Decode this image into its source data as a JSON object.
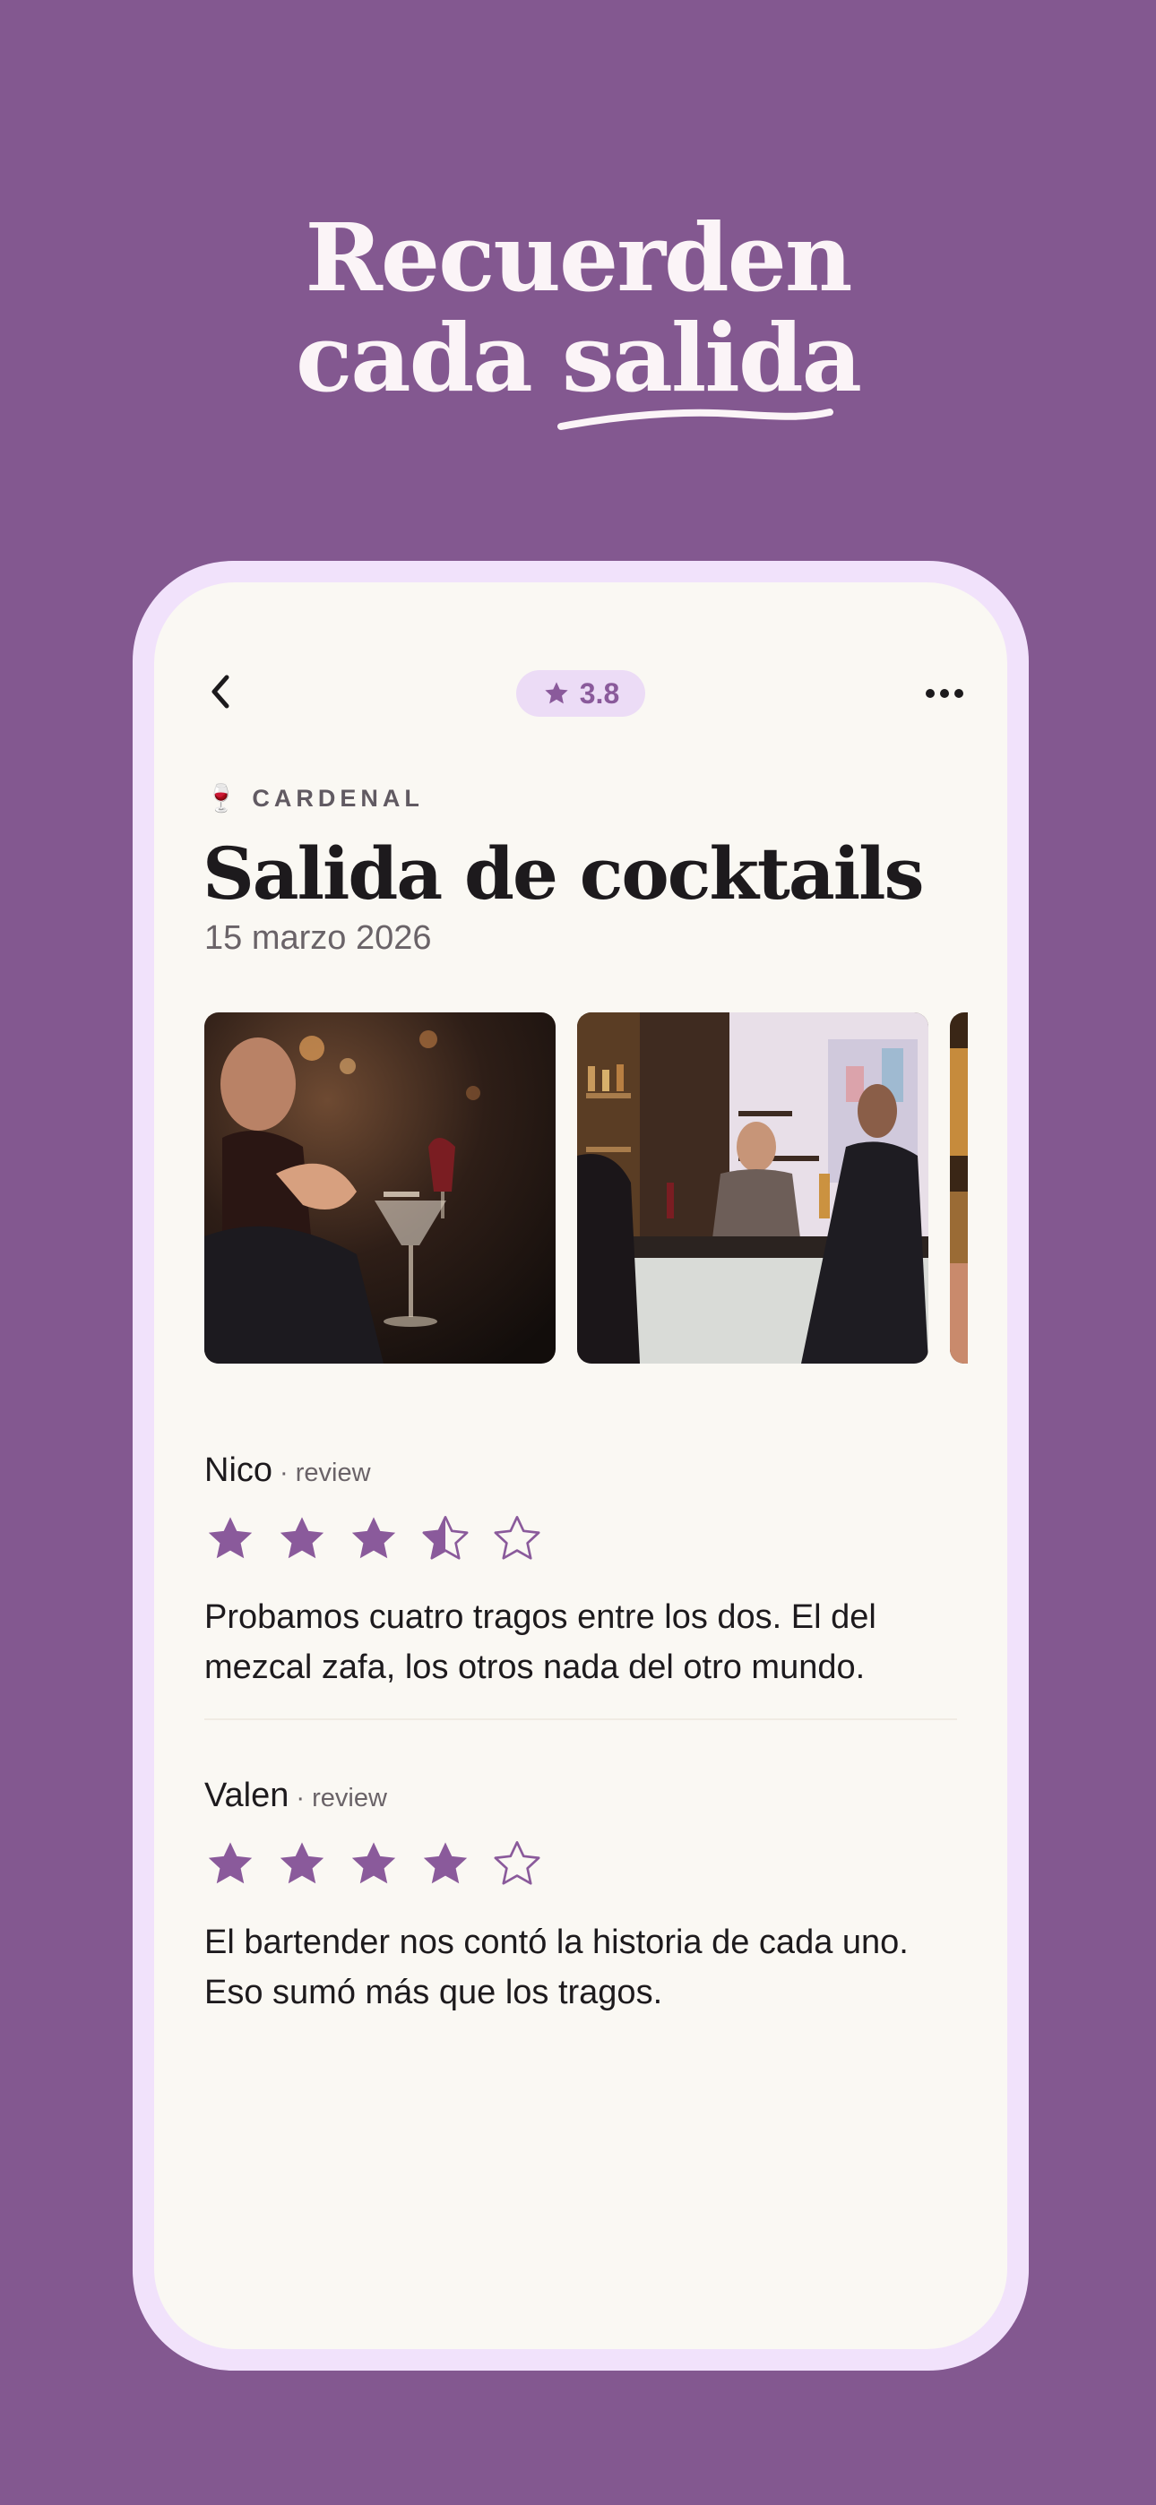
{
  "headline": {
    "line1": "Recuerden",
    "line2_prefix": "cada",
    "line2_highlight": "salida"
  },
  "app": {
    "rating": "3.8",
    "venue": {
      "icon": "wine-glass-icon",
      "emoji": "🍷",
      "name": "CARDENAL"
    },
    "title": "Salida de cocktails",
    "date": "15 marzo 2026",
    "photos": [
      {
        "alt": "couple at cocktail bar"
      },
      {
        "alt": "bartender at bar counter"
      },
      {
        "alt": "bar interior"
      }
    ],
    "reviews": [
      {
        "name": "Nico",
        "tag": "· review",
        "rating": 3.5,
        "text": "Probamos cuatro tragos entre los dos. El del mezcal zafa, los otros nada del otro mundo."
      },
      {
        "name": "Valen",
        "tag": "· review",
        "rating": 4,
        "text": "El bartender nos contó la historia de cada uno. Eso sumó más que los tragos."
      }
    ]
  },
  "colors": {
    "background": "#835890",
    "accent": "#8a5a9b",
    "screen": "#faf8f3",
    "phone_frame": "#f1e2fb"
  }
}
